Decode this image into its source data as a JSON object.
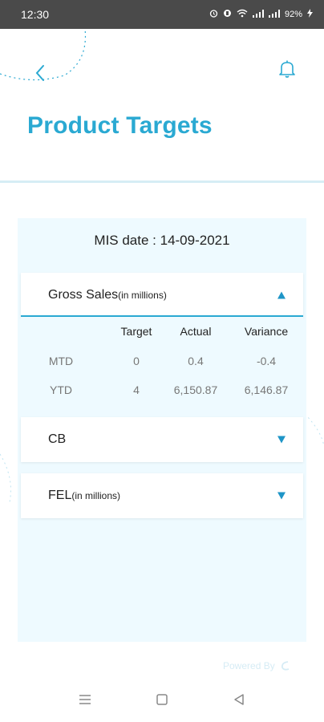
{
  "status_bar": {
    "time": "12:30",
    "battery": "92%"
  },
  "header": {
    "back_icon": "chevron-left-icon",
    "bell_icon": "bell-icon",
    "title": "Product Targets"
  },
  "panel": {
    "mis_date": "MIS date : 14-09-2021",
    "sections": [
      {
        "title": "Gross Sales",
        "superscript": "(in millions)",
        "expanded": true,
        "columns": [
          "Target",
          "Actual",
          "Variance"
        ],
        "rows": [
          {
            "label": "MTD",
            "target": "0",
            "actual": "0.4",
            "variance": "-0.4"
          },
          {
            "label": "YTD",
            "target": "4",
            "actual": "6,150.87",
            "variance": "6,146.87"
          }
        ]
      },
      {
        "title": "CB",
        "superscript": "",
        "expanded": false
      },
      {
        "title": "FEL",
        "superscript": "(in millions)",
        "expanded": false
      }
    ]
  },
  "footer": {
    "powered_by": "Powered By"
  },
  "colors": {
    "accent": "#2aa9d2",
    "arrow": "#1e95c7",
    "panel_bg": "#eefaff",
    "status_bar": "#4a4a4a"
  }
}
